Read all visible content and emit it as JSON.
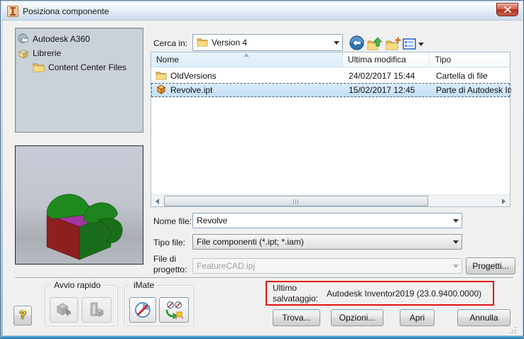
{
  "window": {
    "title": "Posiziona componente"
  },
  "tree": {
    "items": [
      {
        "label": "Autodesk A360",
        "icon": "a360-icon"
      },
      {
        "label": "Librerie",
        "icon": "libraries-icon"
      },
      {
        "label": "Content Center Files",
        "icon": "folder-icon"
      }
    ]
  },
  "browse": {
    "label": "Cerca in:",
    "value": "Version 4",
    "toolbar_icons": [
      "back-icon",
      "up-one-level-icon",
      "new-folder-icon",
      "views-icon"
    ]
  },
  "file_list": {
    "columns": {
      "name": "Nome",
      "modified": "Ultima modifica",
      "type": "Tipo"
    },
    "sort": {
      "column": "Nome",
      "direction": "ascending"
    },
    "rows": [
      {
        "name": "OldVersions",
        "modified": "24/02/2017 15:44",
        "type": "Cartella di file",
        "icon": "folder-icon",
        "selected": false
      },
      {
        "name": "Revolve.ipt",
        "modified": "15/02/2017 12:45",
        "type": "Parte di Autodesk In",
        "icon": "part-icon",
        "selected": true
      }
    ]
  },
  "form": {
    "file_name_label": "Nome file:",
    "file_name_value": "Revolve",
    "file_type_label": "Tipo file:",
    "file_type_value": "File componenti (*.ipt; *.iam)",
    "project_label": "File di progetto:",
    "project_value": "FeatureCAD.ipj",
    "projects_button": "Progetti..."
  },
  "groups": {
    "quick_launch": "Avvio rapido",
    "imate": "iMate"
  },
  "last_saved": {
    "label": "Ultimo salvataggio:",
    "value": "Autodesk Inventor2019 (23.0.9400.0000)"
  },
  "buttons": {
    "find": "Trova...",
    "options": "Opzioni...",
    "open": "Apri",
    "cancel": "Annulla"
  },
  "help": {
    "label": "?"
  },
  "colors": {
    "annotation_red": "#e11212",
    "selection_blue": "#c2def5",
    "titlebar_blue": "#ccdaeb",
    "preview_part_green": "#1f8b1f",
    "preview_part_red": "#8c1f1f",
    "preview_part_magenta": "#a435a4"
  }
}
